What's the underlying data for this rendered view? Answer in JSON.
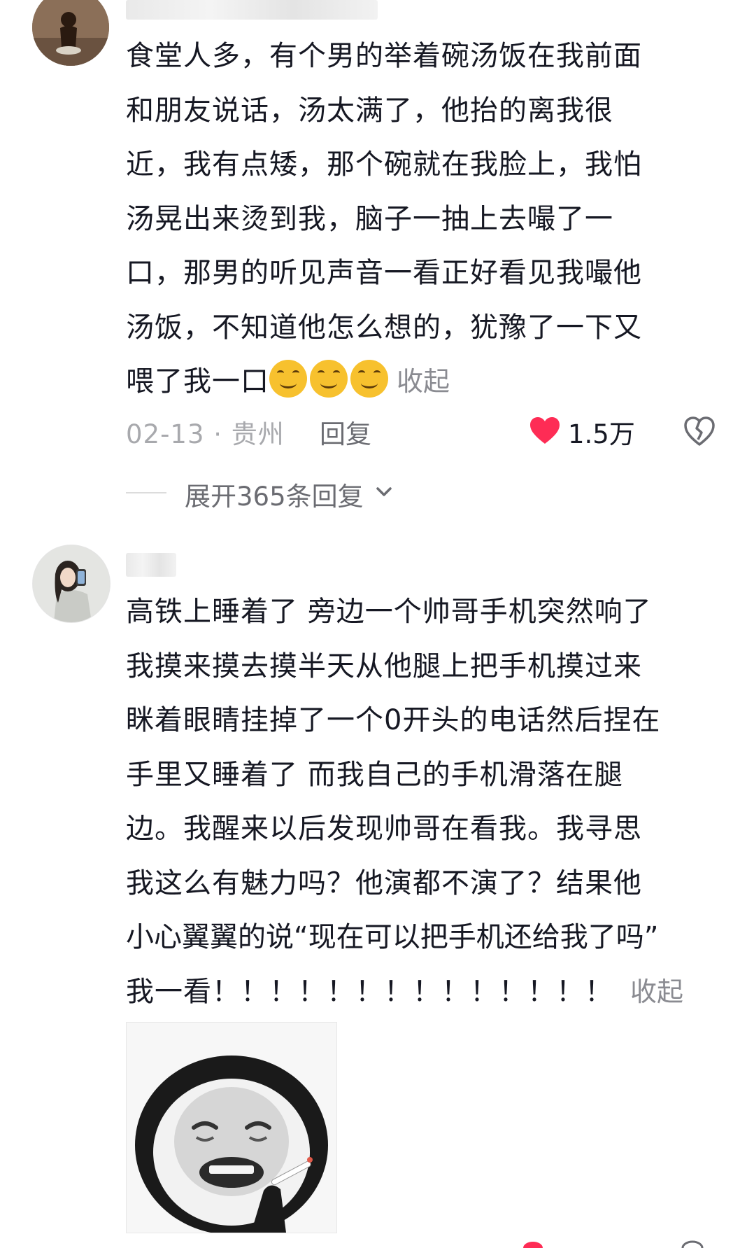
{
  "comments": [
    {
      "text_lines": [
        "食堂人多，有个男的举着碗汤饭在我前面",
        "和朋友说话，汤太满了，他抬的离我很",
        "近，我有点矮，那个碗就在我脸上，我怕",
        "汤晃出来烫到我，脑子一抽上去嘬了一",
        "口，那男的听见声音一看正好看见我嘬他",
        "汤饭，不知道他怎么想的，犹豫了一下又"
      ],
      "last_line": "喂了我一口",
      "emojis": [
        "smiling-face-icon",
        "smiling-face-icon",
        "smiling-face-icon"
      ],
      "collapse_label": "收起",
      "date": "02-13 · 贵州",
      "reply_label": "回复",
      "likes": "1.5万",
      "expand_replies_label": "展开365条回复"
    },
    {
      "text_lines": [
        "高铁上睡着了 旁边一个帅哥手机突然响了",
        "我摸来摸去摸半天从他腿上把手机摸过来",
        "眯着眼睛挂掉了一个0开头的电话然后捏在",
        "手里又睡着了 而我自己的手机滑落在腿",
        "边。我醒来以后发现帅哥在看我。我寻思",
        "我这么有魅力吗？他演都不演了？结果他",
        "小心翼翼的说“现在可以把手机还给我了吗”"
      ],
      "last_line": "我一看！！！！！！！！！！！！！！",
      "collapse_label": "收起",
      "sticker_icon": "crying-panda-sticker-icon"
    }
  ],
  "colors": {
    "text": "#161823",
    "meta_gray": "#a8a9ad",
    "link_gray": "#8a8b91",
    "like_red": "#fe2c55"
  }
}
